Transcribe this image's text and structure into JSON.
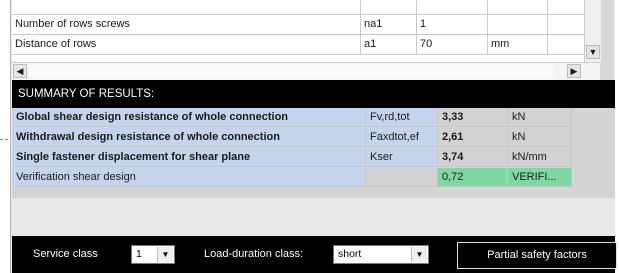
{
  "input_grid": {
    "rows": [
      {
        "name": "Number of rows screws",
        "symbol": "na1",
        "value": "1",
        "unit": ""
      },
      {
        "name": "Distance of rows",
        "symbol": "a1",
        "value": "70",
        "unit": "mm"
      }
    ]
  },
  "summary": {
    "header": "SUMMARY OF RESULTS:",
    "rows": [
      {
        "name": "Global shear design resistance of whole connection",
        "symbol": "Fv,rd,tot",
        "value": "3,33",
        "unit": "kN"
      },
      {
        "name": "Withdrawal design resistance of whole connection",
        "symbol": "Faxdtot,ef",
        "value": "2,61",
        "unit": "kN"
      },
      {
        "name": "Single fastener displacement for shear plane",
        "symbol": "Kser",
        "value": "3,74",
        "unit": "kN/mm"
      },
      {
        "name": "Verification shear design",
        "symbol": "",
        "value": "0,72",
        "unit": "VERIFI..."
      }
    ]
  },
  "bottom_bar": {
    "service_class_label": "Service class",
    "service_class_value": "1",
    "load_duration_label": "Load-duration class:",
    "load_duration_value": "short",
    "partial_safety_button": "Partial safety factors"
  },
  "colors": {
    "blue_cell": "#c4d4ec",
    "green_cell": "#7dd8a4",
    "header_bg": "#000000"
  }
}
